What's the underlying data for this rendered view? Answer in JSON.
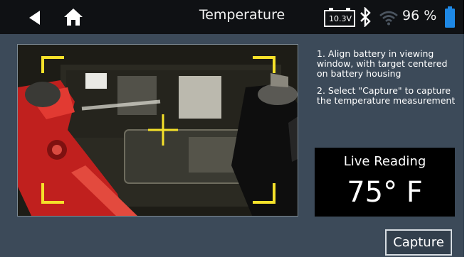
{
  "header": {
    "title": "Temperature",
    "voltage": "10.3V",
    "battery_percent": "96 %"
  },
  "icons": {
    "back": "back-arrow-icon",
    "home": "home-icon",
    "vehicle_battery": "vehicle-battery-icon",
    "bluetooth": "bluetooth-icon",
    "wifi": "wifi-icon",
    "device_battery": "device-battery-icon"
  },
  "instructions": {
    "step1": "1. Align battery in viewing window, with target centered on battery housing",
    "step2": "2. Select \"Capture\" to capture the temperature measurement"
  },
  "live_reading": {
    "label": "Live Reading",
    "value": "75° F"
  },
  "capture_button": {
    "label": "Capture"
  },
  "colors": {
    "background": "#3c4a59",
    "topbar": "#0f1114",
    "reticle": "#f5e12a",
    "accent_blue": "#1e88e5"
  }
}
